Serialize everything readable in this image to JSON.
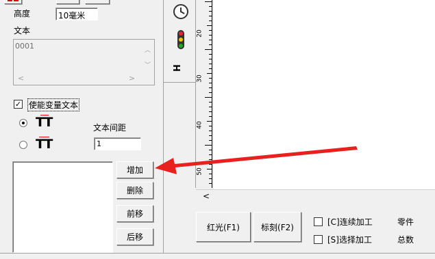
{
  "left_panel": {
    "height_label": "高度",
    "height_value": "10毫米",
    "text_label": "文本",
    "text_value": "0001",
    "enable_variable_text": "使能变量文本",
    "text_spacing_label": "文本间距",
    "text_spacing_value": "1",
    "tt_glyph": "TT",
    "list_buttons": {
      "add": "增加",
      "delete": "删除",
      "move_up": "前移",
      "move_down": "后移"
    }
  },
  "ruler": {
    "labels": [
      "20",
      "30",
      "40",
      "50"
    ]
  },
  "toolbar_icons": [
    "clock-icon",
    "traffic-light-icon",
    "text-flip-icon"
  ],
  "hscroll": {
    "left_arrow": "<"
  },
  "bottom": {
    "red_light_button": "红光(F1)",
    "mark_button": "标刻(F2)",
    "continuous_label": "[C]连续加工",
    "select_label": "[S]选择加工",
    "parts_label": "零件",
    "total_label": "总数"
  },
  "annotation": {
    "arrow_color": "#e8211f"
  }
}
